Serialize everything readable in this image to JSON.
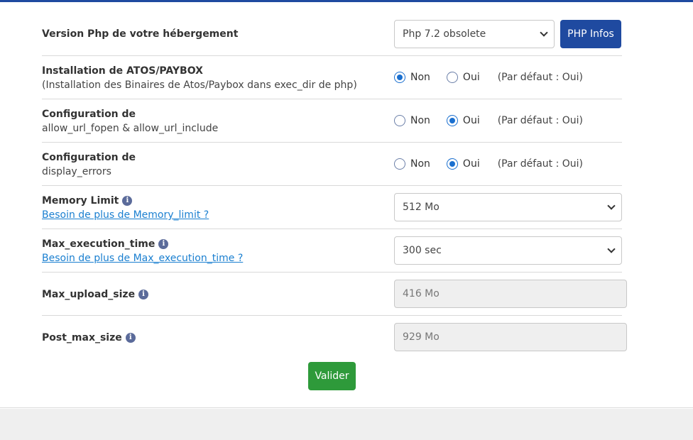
{
  "php_version": {
    "label": "Version Php de votre hébergement",
    "selected": "Php 7.2 obsolete",
    "info_button": "PHP Infos"
  },
  "atos": {
    "title": "Installation de ATOS/PAYBOX",
    "subtitle": "(Installation des Binaires de Atos/Paybox dans exec_dir de php)",
    "option_non": "Non",
    "option_oui": "Oui",
    "selected": "Non",
    "default_note": "(Par défaut : Oui)"
  },
  "url_fopen": {
    "title": "Configuration de",
    "subtitle": "allow_url_fopen & allow_url_include",
    "option_non": "Non",
    "option_oui": "Oui",
    "selected": "Oui",
    "default_note": "(Par défaut : Oui)"
  },
  "display_errors": {
    "title": "Configuration de",
    "subtitle": "display_errors",
    "option_non": "Non",
    "option_oui": "Oui",
    "selected": "Oui",
    "default_note": "(Par défaut : Oui)"
  },
  "memory_limit": {
    "title": "Memory Limit",
    "link": "Besoin de plus de Memory_limit ?",
    "selected": "512 Mo"
  },
  "max_execution_time": {
    "title": "Max_execution_time",
    "link": "Besoin de plus de Max_execution_time ?",
    "selected": "300 sec"
  },
  "max_upload_size": {
    "title": "Max_upload_size",
    "value": "416 Mo"
  },
  "post_max_size": {
    "title": "Post_max_size",
    "value": "929 Mo"
  },
  "submit_label": "Valider",
  "colors": {
    "primary": "#1f4aa0",
    "success": "#2e9a3a",
    "link": "#1a7fd0",
    "radio": "#1a6fcf"
  }
}
